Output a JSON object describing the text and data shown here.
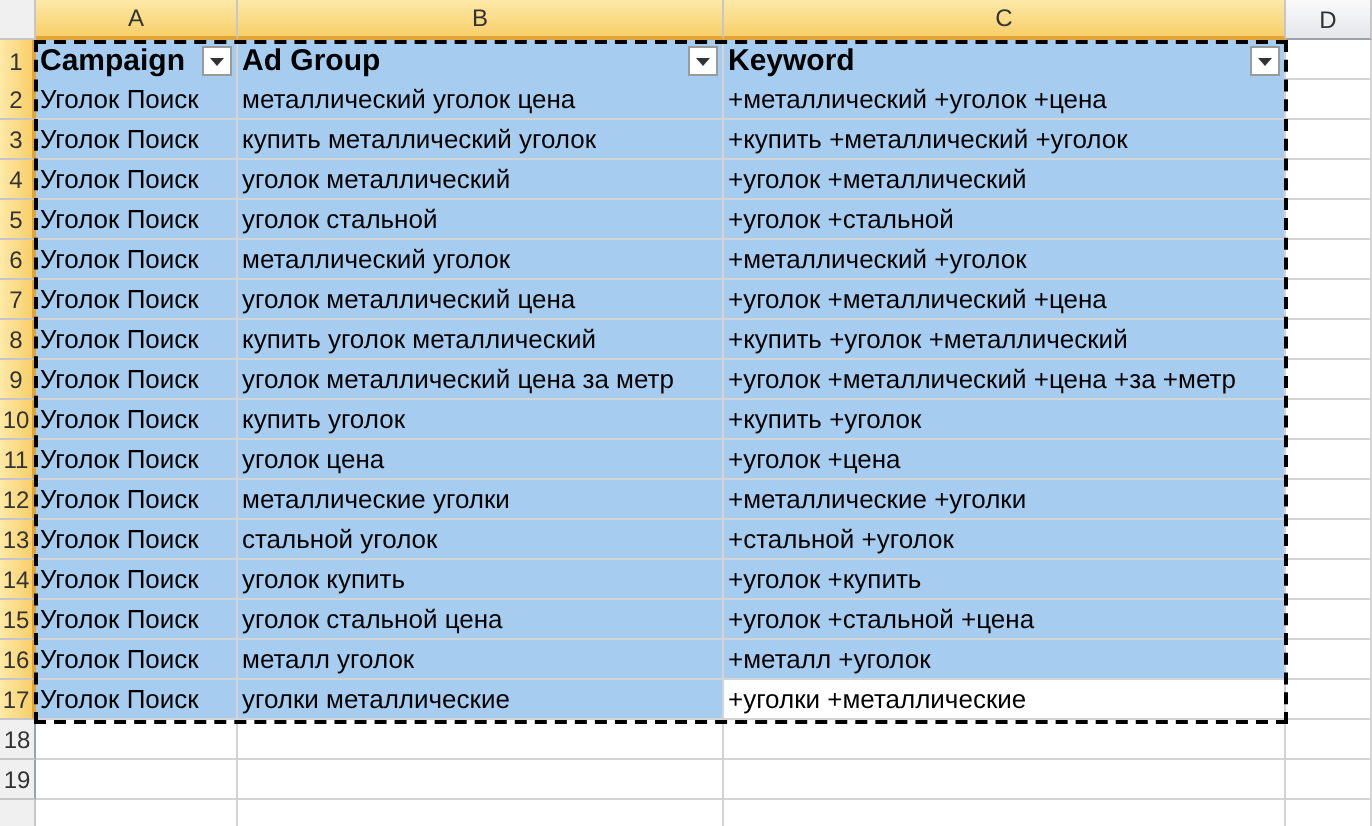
{
  "columns": [
    {
      "label": "A",
      "selected": true
    },
    {
      "label": "B",
      "selected": true
    },
    {
      "label": "C",
      "selected": true
    },
    {
      "label": "D",
      "selected": false
    }
  ],
  "copy_range": {
    "on": true
  },
  "rows": [
    {
      "number": "1",
      "selected": true,
      "kind": "header",
      "cells": [
        {
          "text": "Campaign",
          "selected": true
        },
        {
          "text": "Ad Group",
          "selected": true
        },
        {
          "text": "Keyword",
          "selected": true
        }
      ]
    },
    {
      "number": "2",
      "selected": true,
      "kind": "data",
      "cells": [
        {
          "text": "Уголок Поиск",
          "selected": true
        },
        {
          "text": "металлический уголок цена",
          "selected": true
        },
        {
          "text": "+металлический +уголок +цена",
          "selected": true
        }
      ]
    },
    {
      "number": "3",
      "selected": true,
      "kind": "data",
      "cells": [
        {
          "text": "Уголок Поиск",
          "selected": true
        },
        {
          "text": "купить металлический уголок",
          "selected": true
        },
        {
          "text": "+купить +металлический +уголок",
          "selected": true
        }
      ]
    },
    {
      "number": "4",
      "selected": true,
      "kind": "data",
      "cells": [
        {
          "text": "Уголок Поиск",
          "selected": true
        },
        {
          "text": "уголок металлический",
          "selected": true
        },
        {
          "text": "+уголок +металлический",
          "selected": true
        }
      ]
    },
    {
      "number": "5",
      "selected": true,
      "kind": "data",
      "cells": [
        {
          "text": "Уголок Поиск",
          "selected": true
        },
        {
          "text": "уголок стальной",
          "selected": true
        },
        {
          "text": "+уголок +стальной",
          "selected": true
        }
      ]
    },
    {
      "number": "6",
      "selected": true,
      "kind": "data",
      "cells": [
        {
          "text": "Уголок Поиск",
          "selected": true
        },
        {
          "text": "металлический уголок",
          "selected": true
        },
        {
          "text": "+металлический +уголок",
          "selected": true
        }
      ]
    },
    {
      "number": "7",
      "selected": true,
      "kind": "data",
      "cells": [
        {
          "text": "Уголок Поиск",
          "selected": true
        },
        {
          "text": "уголок металлический цена",
          "selected": true
        },
        {
          "text": "+уголок +металлический +цена",
          "selected": true
        }
      ]
    },
    {
      "number": "8",
      "selected": true,
      "kind": "data",
      "cells": [
        {
          "text": "Уголок Поиск",
          "selected": true
        },
        {
          "text": "купить уголок металлический",
          "selected": true
        },
        {
          "text": "+купить +уголок +металлический",
          "selected": true
        }
      ]
    },
    {
      "number": "9",
      "selected": true,
      "kind": "data",
      "cells": [
        {
          "text": "Уголок Поиск",
          "selected": true
        },
        {
          "text": "уголок металлический цена за метр",
          "selected": true
        },
        {
          "text": "+уголок +металлический +цена +за +метр",
          "selected": true
        }
      ]
    },
    {
      "number": "10",
      "selected": true,
      "kind": "data",
      "cells": [
        {
          "text": "Уголок Поиск",
          "selected": true
        },
        {
          "text": "купить уголок",
          "selected": true
        },
        {
          "text": "+купить +уголок",
          "selected": true
        }
      ]
    },
    {
      "number": "11",
      "selected": true,
      "kind": "data",
      "cells": [
        {
          "text": "Уголок Поиск",
          "selected": true
        },
        {
          "text": "уголок цена",
          "selected": true
        },
        {
          "text": "+уголок +цена",
          "selected": true
        }
      ]
    },
    {
      "number": "12",
      "selected": true,
      "kind": "data",
      "cells": [
        {
          "text": "Уголок Поиск",
          "selected": true
        },
        {
          "text": "металлические уголки",
          "selected": true
        },
        {
          "text": "+металлические +уголки",
          "selected": true
        }
      ]
    },
    {
      "number": "13",
      "selected": true,
      "kind": "data",
      "cells": [
        {
          "text": "Уголок Поиск",
          "selected": true
        },
        {
          "text": "стальной уголок",
          "selected": true
        },
        {
          "text": "+стальной +уголок",
          "selected": true
        }
      ]
    },
    {
      "number": "14",
      "selected": true,
      "kind": "data",
      "cells": [
        {
          "text": "Уголок Поиск",
          "selected": true
        },
        {
          "text": "уголок купить",
          "selected": true
        },
        {
          "text": "+уголок +купить",
          "selected": true
        }
      ]
    },
    {
      "number": "15",
      "selected": true,
      "kind": "data",
      "cells": [
        {
          "text": "Уголок Поиск",
          "selected": true
        },
        {
          "text": "уголок стальной цена",
          "selected": true
        },
        {
          "text": "+уголок +стальной +цена",
          "selected": true
        }
      ]
    },
    {
      "number": "16",
      "selected": true,
      "kind": "data",
      "cells": [
        {
          "text": "Уголок Поиск",
          "selected": true
        },
        {
          "text": "металл уголок",
          "selected": true
        },
        {
          "text": "+металл +уголок",
          "selected": true
        }
      ]
    },
    {
      "number": "17",
      "selected": true,
      "kind": "data",
      "cells": [
        {
          "text": "Уголок Поиск",
          "selected": true
        },
        {
          "text": "уголки металлические",
          "selected": true
        },
        {
          "text": "+уголки +металлические",
          "selected": false
        }
      ]
    },
    {
      "number": "18",
      "selected": false,
      "kind": "data"
    },
    {
      "number": "19",
      "selected": false,
      "kind": "data"
    }
  ]
}
